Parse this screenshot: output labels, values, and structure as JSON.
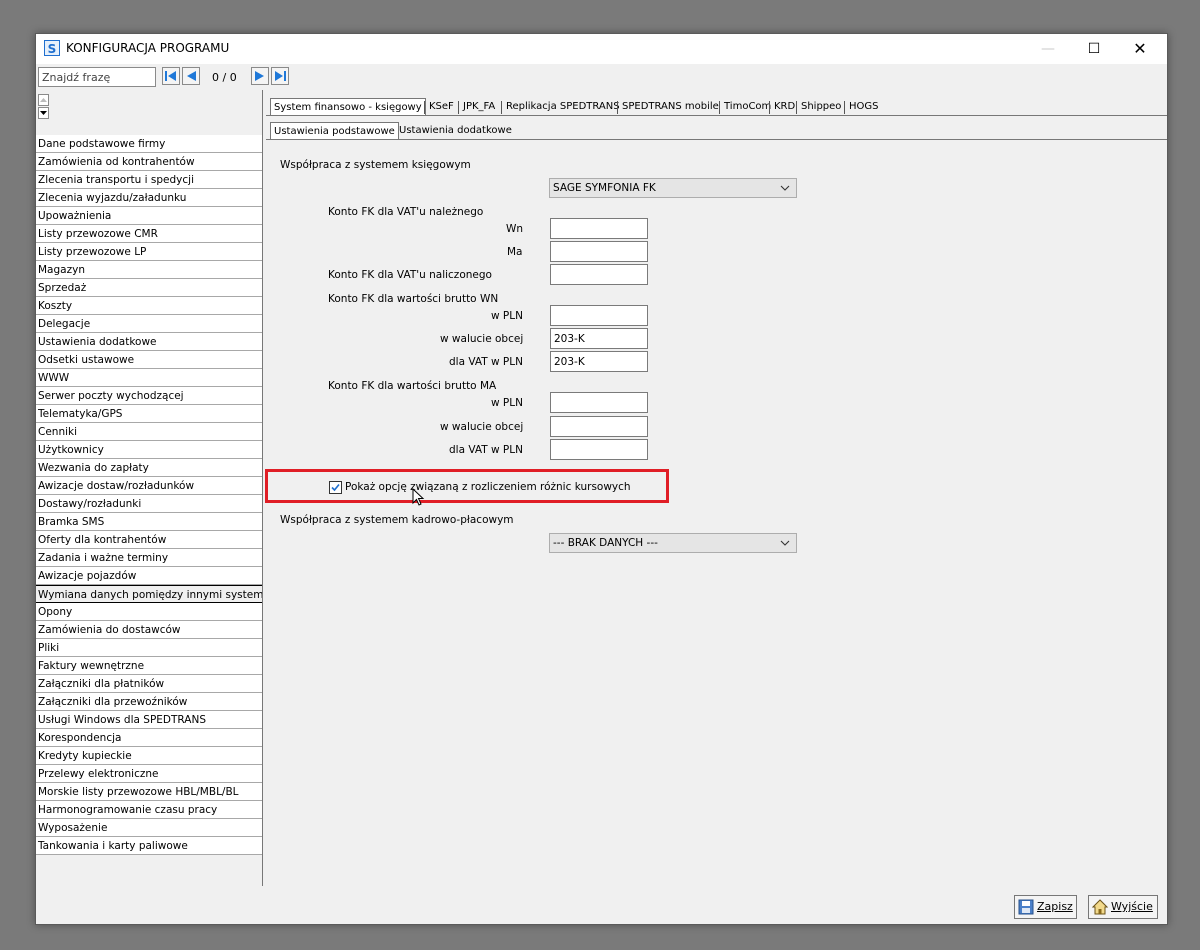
{
  "window": {
    "title": "KONFIGURACJA PROGRAMU",
    "app_icon_letter": "S",
    "minimize": "—",
    "maximize": "☐",
    "close": "✕"
  },
  "search": {
    "placeholder": "Znajdź frazę",
    "counter": "0 / 0"
  },
  "sidebar": {
    "items": [
      "Dane podstawowe firmy",
      "Zamówienia od kontrahentów",
      "Zlecenia transportu i spedycji",
      "Zlecenia wyjazdu/załadunku",
      "Upoważnienia",
      "Listy przewozowe CMR",
      "Listy przewozowe LP",
      "Magazyn",
      "Sprzedaż",
      "Koszty",
      "Delegacje",
      "Ustawienia dodatkowe",
      "Odsetki ustawowe",
      "WWW",
      "Serwer poczty wychodzącej",
      "Telematyka/GPS",
      "Cenniki",
      "Użytkownicy",
      "Wezwania do zapłaty",
      "Awizacje dostaw/rozładunków",
      "Dostawy/rozładunki",
      "Bramka SMS",
      "Oferty dla kontrahentów",
      "Zadania i ważne terminy",
      "Awizacje pojazdów",
      "Wymiana danych pomiędzy innymi systemami",
      "Opony",
      "Zamówienia do dostawców",
      "Pliki",
      "Faktury wewnętrzne",
      "Załączniki dla płatników",
      "Załączniki dla przewoźników",
      "Usługi Windows dla SPEDTRANS",
      "Korespondencja",
      "Kredyty kupieckie",
      "Przelewy elektroniczne",
      "Morskie listy przewozowe HBL/MBL/BL",
      "Harmonogramowanie czasu pracy",
      "Wyposażenie",
      "Tankowania i karty paliwowe"
    ],
    "active_item": "Wymiana danych pomiędzy innymi systemami"
  },
  "tabs": [
    "System finansowo - księgowy",
    "KSeF",
    "JPK_FA",
    "Replikacja SPEDTRANS",
    "SPEDTRANS mobile",
    "TimoCom",
    "KRD",
    "Shippeo",
    "HOGS"
  ],
  "active_tab": "System finansowo - księgowy",
  "subtabs": [
    "Ustawienia podstawowe",
    "Ustawienia dodatkowe"
  ],
  "active_subtab": "Ustawienia podstawowe",
  "form": {
    "fk_section_label": "Współpraca z systemem księgowym",
    "fk_system": "SAGE SYMFONIA FK",
    "vat_nalezny_label": "Konto FK dla VAT'u należnego",
    "wn_label": "Wn",
    "wn_value": "",
    "ma_label": "Ma",
    "ma_value": "",
    "vat_naliczony_label": "Konto FK dla VAT'u naliczonego",
    "vat_naliczony_value": "",
    "brutto_wn_label": "Konto FK dla wartości brutto WN",
    "brutto_ma_label": "Konto FK dla wartości brutto MA",
    "w_pln_label": "w PLN",
    "w_walucie_label": "w walucie obcej",
    "dla_vat_label": "dla VAT w PLN",
    "brutto_wn": {
      "w_pln": "",
      "w_walucie": "203-K",
      "dla_vat": "203-K"
    },
    "brutto_ma": {
      "w_pln": "",
      "w_walucie": "",
      "dla_vat": ""
    },
    "checkbox_label": "Pokaż opcję związaną z rozliczeniem różnic kursowych",
    "checkbox_checked": true,
    "hr_section_label": "Współpraca z systemem kadrowo-płacowym",
    "hr_system": "--- BRAK DANYCH ---"
  },
  "footer": {
    "save_label": "Zapisz",
    "exit_label": "Wyjście"
  },
  "colors": {
    "highlight": "#e01e26",
    "app_icon": "#1f6fcf",
    "nav_button": "#1f78d8"
  }
}
